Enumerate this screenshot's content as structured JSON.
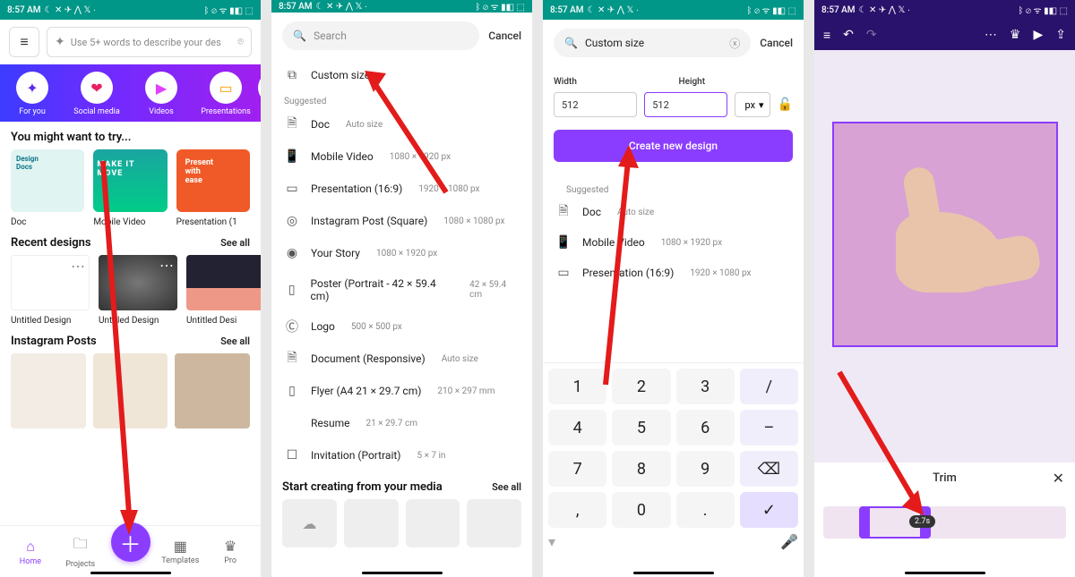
{
  "status": {
    "time": "8:57 AM",
    "left_icons": "☾ ✕ ✈ ⋀ 𝕏 ∙",
    "right_icons": "ᛒ ⊘ ᯤ ▮◧ ⬚"
  },
  "phone1": {
    "search_placeholder": "Use 5+ words to describe your des",
    "chips": [
      {
        "icon": "✦",
        "label": "For you"
      },
      {
        "icon": "❤",
        "label": "Social media"
      },
      {
        "icon": "▶",
        "label": "Videos"
      },
      {
        "icon": "▭",
        "label": "Presentations"
      },
      {
        "icon": "●",
        "label": ""
      }
    ],
    "try_title": "You might want to try...",
    "try": [
      {
        "label": "Doc",
        "bg": "#1fa59a",
        "text": "Design Docs"
      },
      {
        "label": "Mobile Video",
        "bg": "#19a28b",
        "text": "MAKE IT MOVE"
      },
      {
        "label": "Presentation (1",
        "bg": "#f05a28",
        "text": "Present with ease"
      }
    ],
    "recent_title": "Recent designs",
    "seeall": "See all",
    "recent": [
      {
        "label": "Untitled Design",
        "bg": "#fff"
      },
      {
        "label": "Untitled Design",
        "bg": "#555"
      },
      {
        "label": "Untitled Desi",
        "bg": "#334"
      }
    ],
    "insta_title": "Instagram Posts",
    "nav": {
      "home": "Home",
      "projects": "Projects",
      "templates": "Templates",
      "pro": "Pro"
    }
  },
  "phone2": {
    "search_label": "Search",
    "cancel": "Cancel",
    "custom": "Custom size",
    "suggested": "Suggested",
    "items": [
      {
        "icon": "🗎",
        "label": "Doc",
        "sub": "Auto size"
      },
      {
        "icon": "📱",
        "label": "Mobile Video",
        "sub": "1080 × 1920 px"
      },
      {
        "icon": "▭",
        "label": "Presentation (16:9)",
        "sub": "1920 × 1080 px"
      },
      {
        "icon": "◎",
        "label": "Instagram Post (Square)",
        "sub": "1080 × 1080 px"
      },
      {
        "icon": "◉",
        "label": "Your Story",
        "sub": "1080 × 1920 px"
      },
      {
        "icon": "▯",
        "label": "Poster (Portrait - 42 × 59.4 cm)",
        "sub": "42 × 59.4 cm"
      },
      {
        "icon": "Ⓒ",
        "label": "Logo",
        "sub": "500 × 500 px"
      },
      {
        "icon": "🗎",
        "label": "Document (Responsive)",
        "sub": "Auto size"
      },
      {
        "icon": "▯",
        "label": "Flyer (A4 21 × 29.7 cm)",
        "sub": "210 × 297 mm"
      },
      {
        "icon": " ",
        "label": "Resume",
        "sub": "21 × 29.7 cm"
      },
      {
        "icon": "☐",
        "label": "Invitation (Portrait)",
        "sub": "5 × 7 in"
      }
    ],
    "media_title": "Start creating from your media",
    "media_seeall": "See all"
  },
  "phone3": {
    "search_value": "Custom size",
    "cancel": "Cancel",
    "width_label": "Width",
    "height_label": "Height",
    "width_value": "512",
    "height_value": "512",
    "unit": "px",
    "create": "Create new design",
    "suggested": "Suggested",
    "items": [
      {
        "icon": "🗎",
        "label": "Doc",
        "sub": "Auto size"
      },
      {
        "icon": "📱",
        "label": "Mobile Video",
        "sub": "1080 × 1920 px"
      },
      {
        "icon": "▭",
        "label": "Presentation (16:9)",
        "sub": "1920 × 1080 px"
      }
    ],
    "keypad": {
      "r1": [
        "1",
        "2",
        "3",
        "/"
      ],
      "r2": [
        "4",
        "5",
        "6",
        "–"
      ],
      "r3": [
        "7",
        "8",
        "9",
        "⌫"
      ],
      "r4": [
        ",",
        "0",
        ".",
        "✓"
      ]
    }
  },
  "phone4": {
    "trim_title": "Trim",
    "time_pill": "2.7s"
  }
}
